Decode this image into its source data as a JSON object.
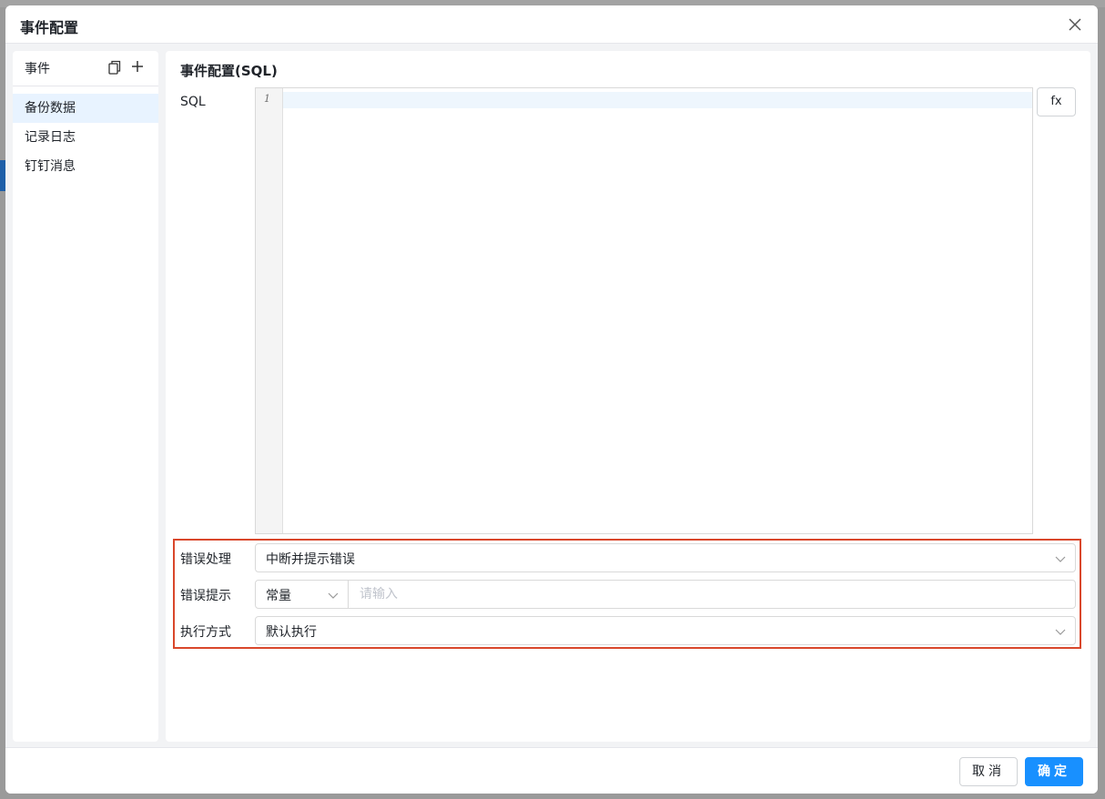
{
  "modal": {
    "title": "事件配置",
    "close_icon": "close-icon"
  },
  "sidebar": {
    "header_label": "事件",
    "copy_icon": "copy-icon",
    "add_icon": "plus-icon",
    "items": [
      {
        "label": "备份数据",
        "active": true
      },
      {
        "label": "记录日志",
        "active": false
      },
      {
        "label": "钉钉消息",
        "active": false
      }
    ]
  },
  "config": {
    "section_title": "事件配置(SQL)",
    "sql_label": "SQL",
    "editor": {
      "line_numbers": [
        "1"
      ],
      "content": ""
    },
    "fx_label": "fx",
    "error_handling": {
      "label": "错误处理",
      "value": "中断并提示错误"
    },
    "error_message": {
      "label": "错误提示",
      "type_value": "常量",
      "placeholder": "请输入",
      "value": ""
    },
    "execution_mode": {
      "label": "执行方式",
      "value": "默认执行"
    }
  },
  "footer": {
    "cancel_label": "取消",
    "ok_label": "确定"
  },
  "colors": {
    "primary": "#1890ff",
    "highlight_border": "#d9472b",
    "active_item_bg": "#e8f3ff"
  }
}
